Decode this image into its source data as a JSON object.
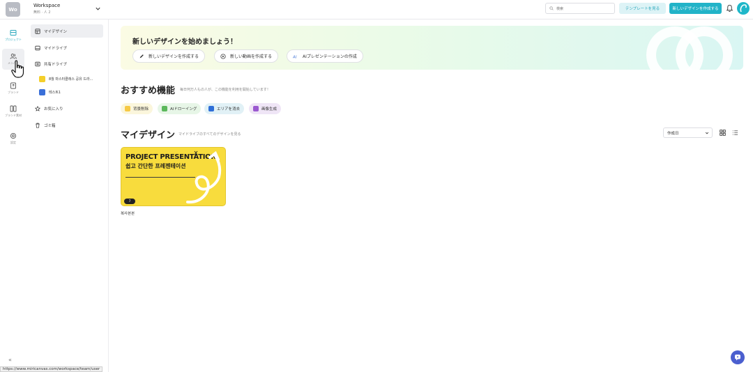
{
  "topbar": {
    "workspace_initials": "Wo",
    "workspace_name": "Workspace",
    "workspace_plan": "無料 · 人 2",
    "search_placeholder": "検索",
    "template_button": "テンプレートを見る",
    "create_button": "新しいデザインを作成する"
  },
  "rail": {
    "items": [
      {
        "label": "プロジェクト",
        "icon": "folder-icon"
      },
      {
        "label": "メンバー",
        "icon": "members-icon"
      },
      {
        "label": "ブランド",
        "icon": "brand-icon"
      },
      {
        "label": "ブランド素材",
        "icon": "brand-assets-icon"
      },
      {
        "label": "設定",
        "icon": "settings-icon"
      }
    ],
    "collapse": "«"
  },
  "sidebar": {
    "items": [
      {
        "label": "マイデザイン"
      },
      {
        "label": "マイドライブ"
      },
      {
        "label": "共有ドライブ"
      },
      {
        "label": "お気に入り"
      },
      {
        "label": "ゴミ箱"
      }
    ],
    "shared": [
      {
        "label": "8월 마스터클래스 공유 드라...",
        "color": "#f4cf2a"
      },
      {
        "label": "테스트1",
        "color": "#3a6fd8"
      }
    ]
  },
  "hero": {
    "title": "新しいデザインを始めましょう！",
    "buttons": [
      "新しいデザインを作成する",
      "新しい動画を作成する",
      "AIプレゼンテーションの作成"
    ]
  },
  "recommended": {
    "title": "おすすめ機能",
    "subtitle": "毎日何万人もの人が、この機能を利用を開始しています！",
    "chips": [
      {
        "label": "背景削除",
        "color": "#f6c945",
        "bg": "#fbf6dc"
      },
      {
        "label": "AIドローイング",
        "color": "#5cb85c",
        "bg": "#e7f6e7"
      },
      {
        "label": "エリアを消去",
        "color": "#2f6fd8",
        "bg": "#e1f1f6"
      },
      {
        "label": "画像生成",
        "color": "#9b59d0",
        "bg": "#efe5f6"
      }
    ]
  },
  "my_designs": {
    "title": "マイデザイン",
    "subtitle": "マイドライブのすべてのデザインを見る",
    "sort": "作成日",
    "cards": [
      {
        "title": "PROJECT PRESENTATION",
        "subtitle": "쉽고 간단한 프레젠테이션",
        "badge": "7",
        "name": "복사본본"
      }
    ]
  },
  "status_url": "https://www.miricanvas.com/workspace/team/user"
}
